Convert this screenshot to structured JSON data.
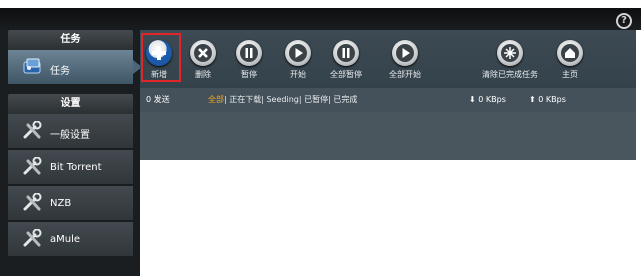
{
  "help_label": "?",
  "sidebar": {
    "task_header": "任务",
    "task_item": "任务",
    "settings_header": "设置",
    "items": [
      {
        "label": "一般设置",
        "icon": "tools-icon"
      },
      {
        "label": "Bit Torrent",
        "icon": "tools-icon"
      },
      {
        "label": "NZB",
        "icon": "tools-icon"
      },
      {
        "label": "aMule",
        "icon": "tools-icon"
      }
    ]
  },
  "toolbar": {
    "add": "新增",
    "delete": "删除",
    "pause": "暂停",
    "start": "开始",
    "pause_all": "全部暂停",
    "start_all": "全部开始",
    "clear_completed": "清除已完成任务",
    "home": "主页"
  },
  "status": {
    "count": "0 发送",
    "filter_all": "全部",
    "filter_rest": "| 正在下载| Seeding| 已暂停| 已完成",
    "download_speed": "0 KBps",
    "upload_speed": "0 KBps"
  },
  "colors": {
    "accent": "#f5a623",
    "highlight_frame": "#e0262b",
    "sidebar_active": "#5a7486"
  }
}
